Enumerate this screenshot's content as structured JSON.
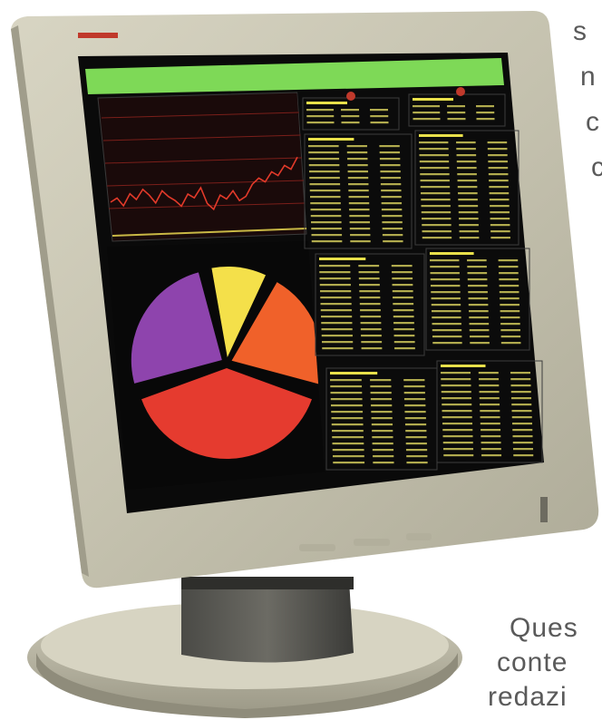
{
  "side_text_top": [
    "s",
    "n",
    "c",
    "c"
  ],
  "side_text_bottom": [
    "Ques",
    "conte",
    "redazi"
  ],
  "colors": {
    "bezel": "#c9c6b3",
    "screen": "#0a0a0a",
    "header_bar": "#7ed957",
    "panel_text": "#e8e04a",
    "chart_line": "#c0392b",
    "pie_purple": "#8e44ad",
    "pie_yellow": "#f4e04a",
    "pie_orange": "#f0612a",
    "pie_red": "#e53b2f"
  },
  "pie_slices": [
    {
      "name": "yellow-slice",
      "color": "#f4e04a",
      "start": -100,
      "end": -65
    },
    {
      "name": "orange-slice",
      "color": "#f0612a",
      "start": -60,
      "end": 15
    },
    {
      "name": "red-slice",
      "color": "#e53b2f",
      "start": 20,
      "end": 160
    },
    {
      "name": "purple-slice",
      "color": "#8e44ad",
      "start": 165,
      "end": 255
    }
  ],
  "line_series": [
    60,
    62,
    58,
    64,
    61,
    66,
    63,
    59,
    65,
    62,
    60,
    57,
    63,
    61,
    66,
    58,
    55,
    62,
    60,
    64,
    59,
    61,
    67,
    70,
    68,
    73,
    71,
    76,
    74,
    80
  ]
}
